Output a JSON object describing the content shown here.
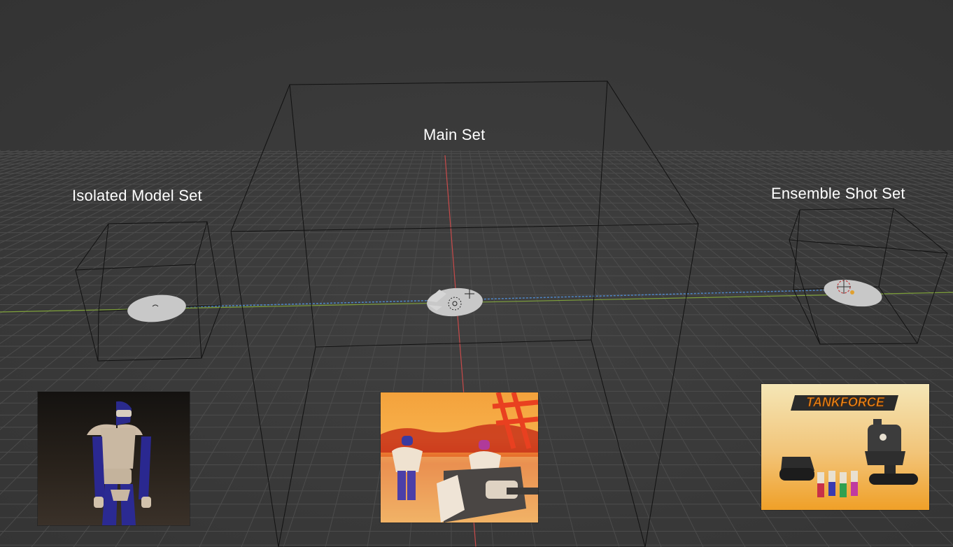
{
  "viewport": {
    "background": "#3b3b3b",
    "grid_color": "#4a4a4a",
    "x_axis_color": "#7fa13b",
    "y_axis_color": "#c84a4a",
    "object_color": "#c8c8c8"
  },
  "sets": [
    {
      "label": "Isolated Model Set",
      "thumbnail_icon": "robot-figure-render"
    },
    {
      "label": "Main Set",
      "thumbnail_icon": "desert-tank-scene-render"
    },
    {
      "label": "Ensemble Shot Set",
      "thumbnail_icon": "tankforce-ensemble-render"
    }
  ],
  "ensemble_logo": "TANKFORCE"
}
